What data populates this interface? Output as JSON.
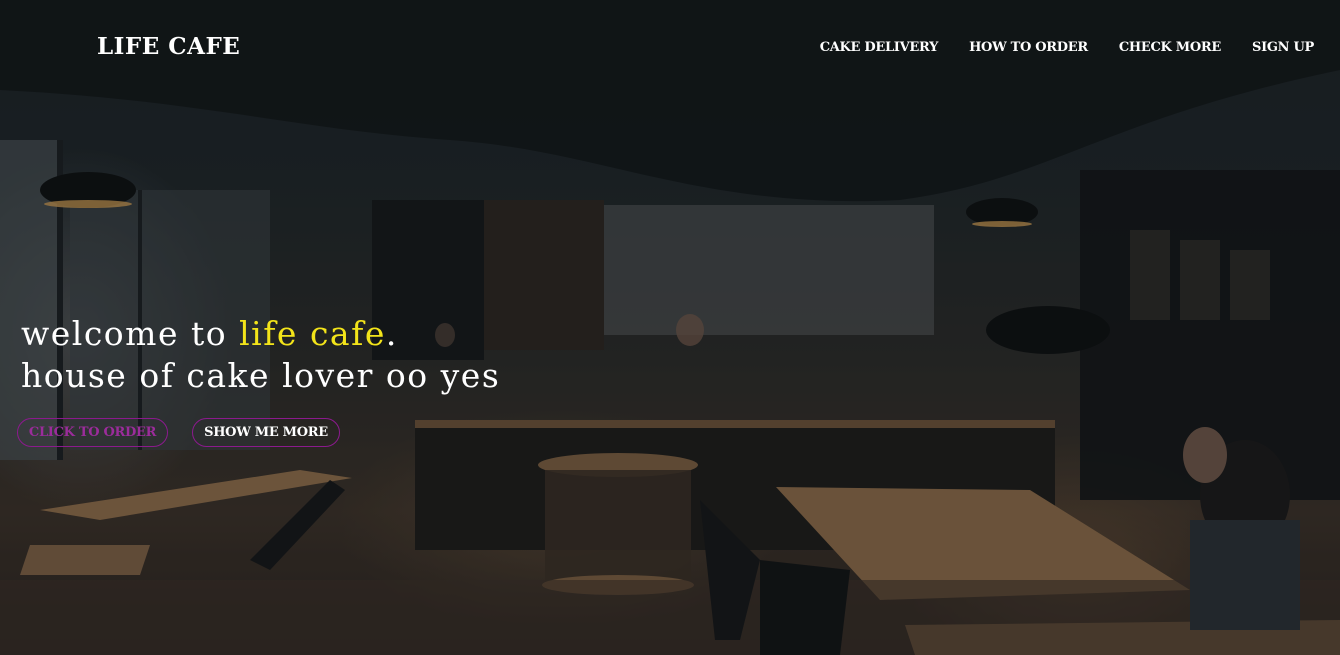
{
  "brand": {
    "logo": "LIFE CAFE"
  },
  "nav": {
    "items": [
      "CAKE DELIVERY",
      "HOW TO ORDER",
      "CHECK MORE",
      "SIGN UP"
    ]
  },
  "hero": {
    "line1_prefix": "welcome to ",
    "line1_accent": "life cafe",
    "line1_suffix": ".",
    "line2": "house of cake lover oo yes",
    "primary_button": "CLICK TO ORDER",
    "secondary_button": "SHOW ME MORE"
  },
  "colors": {
    "accent_yellow": "#f3e41a",
    "button_border": "#8b1a8d",
    "primary_button_text": "#9b2c9b"
  },
  "background_image": "dark cafe interior photo"
}
